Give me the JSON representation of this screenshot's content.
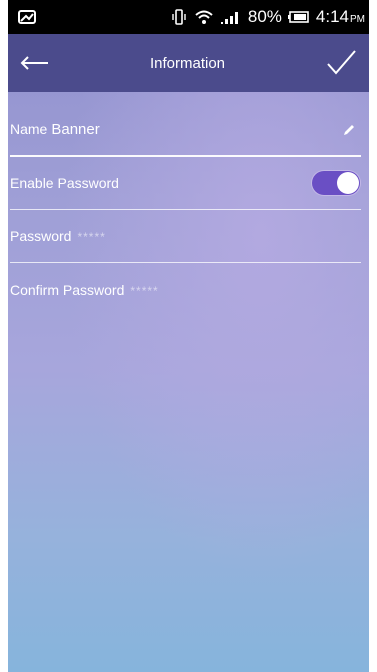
{
  "status_bar": {
    "battery_percent": "80%",
    "time": "4:14",
    "ampm": "PM"
  },
  "app_bar": {
    "title": "Information"
  },
  "form": {
    "name_label": "Name",
    "name_value": "Banner",
    "enable_password_label": "Enable Password",
    "enable_password_on": true,
    "password_label": "Password",
    "password_mask": "*****",
    "confirm_password_label": "Confirm Password",
    "confirm_password_mask": "*****"
  },
  "colors": {
    "app_bar": "#4b4b8c",
    "toggle_on": "#6a4fc4",
    "status_bar": "#000000"
  }
}
